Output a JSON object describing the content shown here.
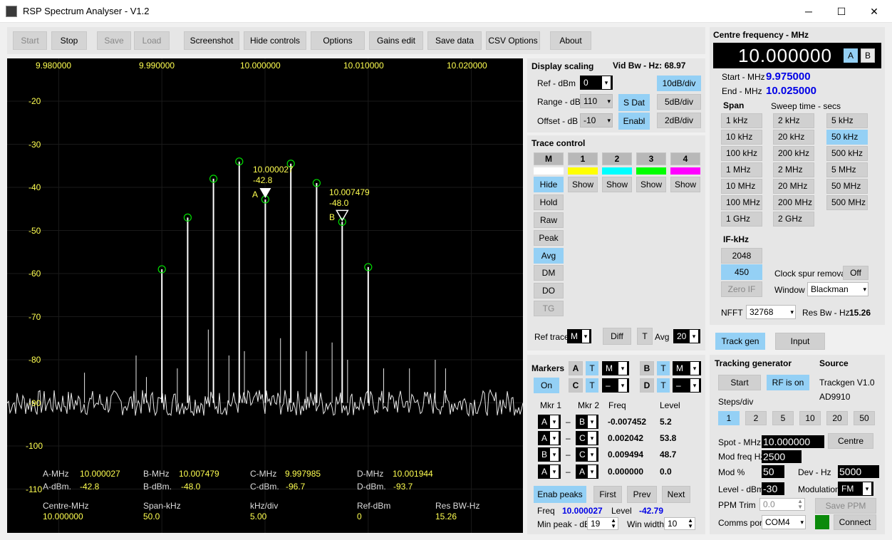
{
  "window": {
    "title": "RSP Spectrum Analyser - V1.2",
    "min": "─",
    "max": "☐",
    "close": "✕"
  },
  "toolbar": {
    "start": "Start",
    "stop": "Stop",
    "save": "Save",
    "load": "Load",
    "screenshot": "Screenshot",
    "hide_controls": "Hide controls",
    "options": "Options",
    "gains_edit": "Gains edit",
    "save_data": "Save data",
    "csv_options": "CSV Options",
    "about": "About"
  },
  "plot": {
    "x_ticks": [
      "9.980000",
      "9.990000",
      "10.000000",
      "10.010000",
      "10.020000"
    ],
    "y_ticks": [
      "-20",
      "-30",
      "-40",
      "-50",
      "-60",
      "-70",
      "-80",
      "-90",
      "-100",
      "-110"
    ],
    "marker_a": {
      "freq": "10.000027",
      "level": "-42.8",
      "letter": "A"
    },
    "marker_b": {
      "freq": "10.007479",
      "level": "-48.0",
      "letter": "B"
    },
    "readout": {
      "a_mhz_lbl": "A-MHz",
      "a_mhz": "10.000027",
      "a_dbm_lbl": "A-dBm.",
      "a_dbm": "-42.8",
      "b_mhz_lbl": "B-MHz",
      "b_mhz": "10.007479",
      "b_dbm_lbl": "B-dBm.",
      "b_dbm": "-48.0",
      "c_mhz_lbl": "C-MHz",
      "c_mhz": "9.997985",
      "c_dbm_lbl": "C-dBm.",
      "c_dbm": "-96.7",
      "d_mhz_lbl": "D-MHz",
      "d_mhz": "10.001944",
      "d_dbm_lbl": "D-dBm.",
      "d_dbm": "-93.7",
      "centre_lbl": "Centre-MHz",
      "centre": "10.000000",
      "span_lbl": "Span-kHz",
      "span": "50.0",
      "khzdiv_lbl": "kHz/div",
      "khzdiv": "5.00",
      "ref_lbl": "Ref-dBm",
      "ref": "0",
      "resbw_lbl": "Res BW-Hz",
      "resbw": "15.26"
    }
  },
  "chart_data": {
    "type": "line",
    "xlabel": "",
    "ylabel": "",
    "xlim": [
      9.975,
      10.025
    ],
    "ylim": [
      -115,
      -13
    ],
    "noise_floor": -90,
    "peaks": [
      {
        "x": 9.99,
        "y": -59
      },
      {
        "x": 9.9925,
        "y": -47
      },
      {
        "x": 9.995,
        "y": -38
      },
      {
        "x": 9.9975,
        "y": -34
      },
      {
        "x": 10.000027,
        "y": -42.8
      },
      {
        "x": 10.0025,
        "y": -34.5
      },
      {
        "x": 10.005,
        "y": -39
      },
      {
        "x": 10.007479,
        "y": -48
      },
      {
        "x": 10.01,
        "y": -58.5
      }
    ],
    "minor_spurs": [
      {
        "x": 9.9825,
        "y": -83
      },
      {
        "x": 9.9875,
        "y": -79
      },
      {
        "x": 9.9885,
        "y": -84
      },
      {
        "x": 9.9915,
        "y": -82
      },
      {
        "x": 9.9945,
        "y": -73
      },
      {
        "x": 9.9965,
        "y": -79
      },
      {
        "x": 9.998,
        "y": -78
      },
      {
        "x": 10.0,
        "y": -68
      },
      {
        "x": 10.0015,
        "y": -75
      },
      {
        "x": 10.004,
        "y": -78
      },
      {
        "x": 10.0065,
        "y": -76
      },
      {
        "x": 10.008,
        "y": -80
      },
      {
        "x": 10.0115,
        "y": -82
      },
      {
        "x": 10.014,
        "y": -82
      },
      {
        "x": 10.0165,
        "y": -80
      },
      {
        "x": 10.0175,
        "y": -82
      }
    ]
  },
  "display_scaling": {
    "title": "Display scaling",
    "vid_bw": "Vid Bw - Hz: 68.97",
    "ref_lbl": "Ref - dBm",
    "ref": "0",
    "range_lbl": "Range - dB",
    "range": "110",
    "offset_lbl": "Offset - dB",
    "offset": "-10",
    "btn_10": "10dB/div",
    "btn_5": "5dB/div",
    "btn_2": "2dB/div",
    "sdat": "S Dat",
    "enabl": "Enabl"
  },
  "trace_control": {
    "title": "Trace control",
    "tabs": [
      "M",
      "1",
      "2",
      "3",
      "4"
    ],
    "hide": "Hide",
    "show": "Show",
    "hold": "Hold",
    "raw": "Raw",
    "peak": "Peak",
    "avg": "Avg",
    "dm": "DM",
    "do": "DO",
    "tg": "TG",
    "ref_trace_lbl": "Ref trace",
    "ref_trace": "M",
    "diff": "Diff",
    "t": "T",
    "avg_lbl": "Avg",
    "avg_val": "20",
    "colors": [
      "#ffffff",
      "#ffff00",
      "#00ffff",
      "#00ff00",
      "#ff00ff"
    ]
  },
  "markers": {
    "title": "Markers",
    "on": "On",
    "a": "A",
    "b": "B",
    "c": "C",
    "d": "D",
    "t": "T",
    "a_mode": "M",
    "b_mode": "M",
    "c_mode": "–",
    "d_mode": "–",
    "hdr_mkr1": "Mkr 1",
    "hdr_mkr2": "Mkr 2",
    "hdr_freq": "Freq",
    "hdr_level": "Level",
    "rows": [
      {
        "m1": "A",
        "m2": "B",
        "freq": "-0.007452",
        "level": "5.2"
      },
      {
        "m1": "A",
        "m2": "C",
        "freq": "0.002042",
        "level": "53.8"
      },
      {
        "m1": "B",
        "m2": "C",
        "freq": "0.009494",
        "level": "48.7"
      },
      {
        "m1": "A",
        "m2": "A",
        "freq": "0.000000",
        "level": "0.0"
      }
    ],
    "dash": "–",
    "enab_peaks": "Enab peaks",
    "first": "First",
    "prev": "Prev",
    "next": "Next",
    "freq_lbl": "Freq",
    "freq": "10.000027",
    "level_lbl": "Level",
    "level": "-42.79",
    "minpeak_lbl": "Min peak - dB",
    "minpeak": "19",
    "winwidth_lbl": "Win width",
    "winwidth": "10"
  },
  "centre": {
    "title": "Centre frequency - MHz",
    "value": "10.000000",
    "a": "A",
    "b": "B",
    "start_lbl": "Start - MHz",
    "start": "9.975000",
    "end_lbl": "End - MHz",
    "end": "10.025000",
    "span_lbl": "Span",
    "sweep_lbl": "Sweep time - secs",
    "span_btns": [
      "1 kHz",
      "10 kHz",
      "100 kHz",
      "1 MHz",
      "10 MHz",
      "100 MHz",
      "1 GHz"
    ],
    "sweep_col2": [
      "2 kHz",
      "20 kHz",
      "200 kHz",
      "2 MHz",
      "20 MHz",
      "200 MHz",
      "2 GHz"
    ],
    "sweep_col3": [
      "5 kHz",
      "50 kHz",
      "500 kHz",
      "5 MHz",
      "50 MHz",
      "500 MHz"
    ],
    "if_lbl": "IF-kHz",
    "if_2048": "2048",
    "if_450": "450",
    "zero_if": "Zero IF",
    "clock_lbl": "Clock spur removal",
    "clock": "Off",
    "window_lbl": "Window",
    "window": "Blackman",
    "nfft_lbl": "NFFT",
    "nfft": "32768",
    "resbw_lbl": "Res Bw - Hz",
    "resbw": "15.26"
  },
  "tabs": {
    "track": "Track gen",
    "input": "Input"
  },
  "trackgen": {
    "title": "Tracking generator",
    "source_lbl": "Source",
    "start": "Start",
    "rf": "RF is on",
    "src1": "Trackgen V1.0",
    "src2": "AD9910",
    "steps_lbl": "Steps/div",
    "steps": [
      "1",
      "2",
      "5",
      "10",
      "20",
      "50"
    ],
    "spot_lbl": "Spot - MHz",
    "spot": "10.000000",
    "centre_btn": "Centre",
    "modfreq_lbl": "Mod freq Hz",
    "modfreq": "2500",
    "modpct_lbl": "Mod %",
    "modpct": "50",
    "dev_lbl": "Dev - Hz",
    "dev": "5000",
    "level_lbl": "Level - dBm",
    "level": "-30",
    "modulation_lbl": "Modulation",
    "modulation": "FM",
    "ppm_lbl": "PPM Trim",
    "ppm": "0.0",
    "save_ppm": "Save PPM",
    "comms_lbl": "Comms port",
    "comms": "COM4",
    "connect": "Connect"
  }
}
